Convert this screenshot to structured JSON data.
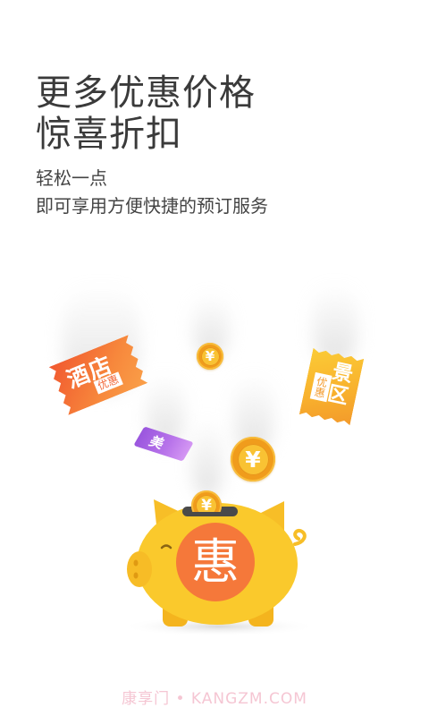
{
  "page": {
    "background": "#FFFFFF"
  },
  "headline": {
    "line1": "更多优惠价格",
    "line2": "惊喜折扣",
    "color": "#3A3A3A"
  },
  "subheadline": {
    "line1": "轻松一点",
    "line2": "即可享用方便快捷的预订服务",
    "color": "#444444"
  },
  "illustration": {
    "hotel_ticket": {
      "label": "酒店",
      "tag": "优惠",
      "color": "#F26A36"
    },
    "scenic_ticket": {
      "label": "景区",
      "tag": "优惠",
      "color": "#F9B62C"
    },
    "food_ticket": {
      "label": "美",
      "color": "#B06BE6"
    },
    "coins": [
      {
        "icon": "yuan-coin-icon",
        "symbol": "¥"
      },
      {
        "icon": "yuan-coin-icon",
        "symbol": "¥"
      },
      {
        "icon": "yuan-coin-icon",
        "symbol": "¥"
      }
    ],
    "piggy_bank": {
      "icon": "piggy-bank-icon",
      "badge": "惠",
      "body_color": "#FAC92C",
      "badge_color": "#F5783A"
    }
  },
  "watermark": {
    "text": "康享门 • KANGZM.COM",
    "color": "#F5C6D3"
  }
}
